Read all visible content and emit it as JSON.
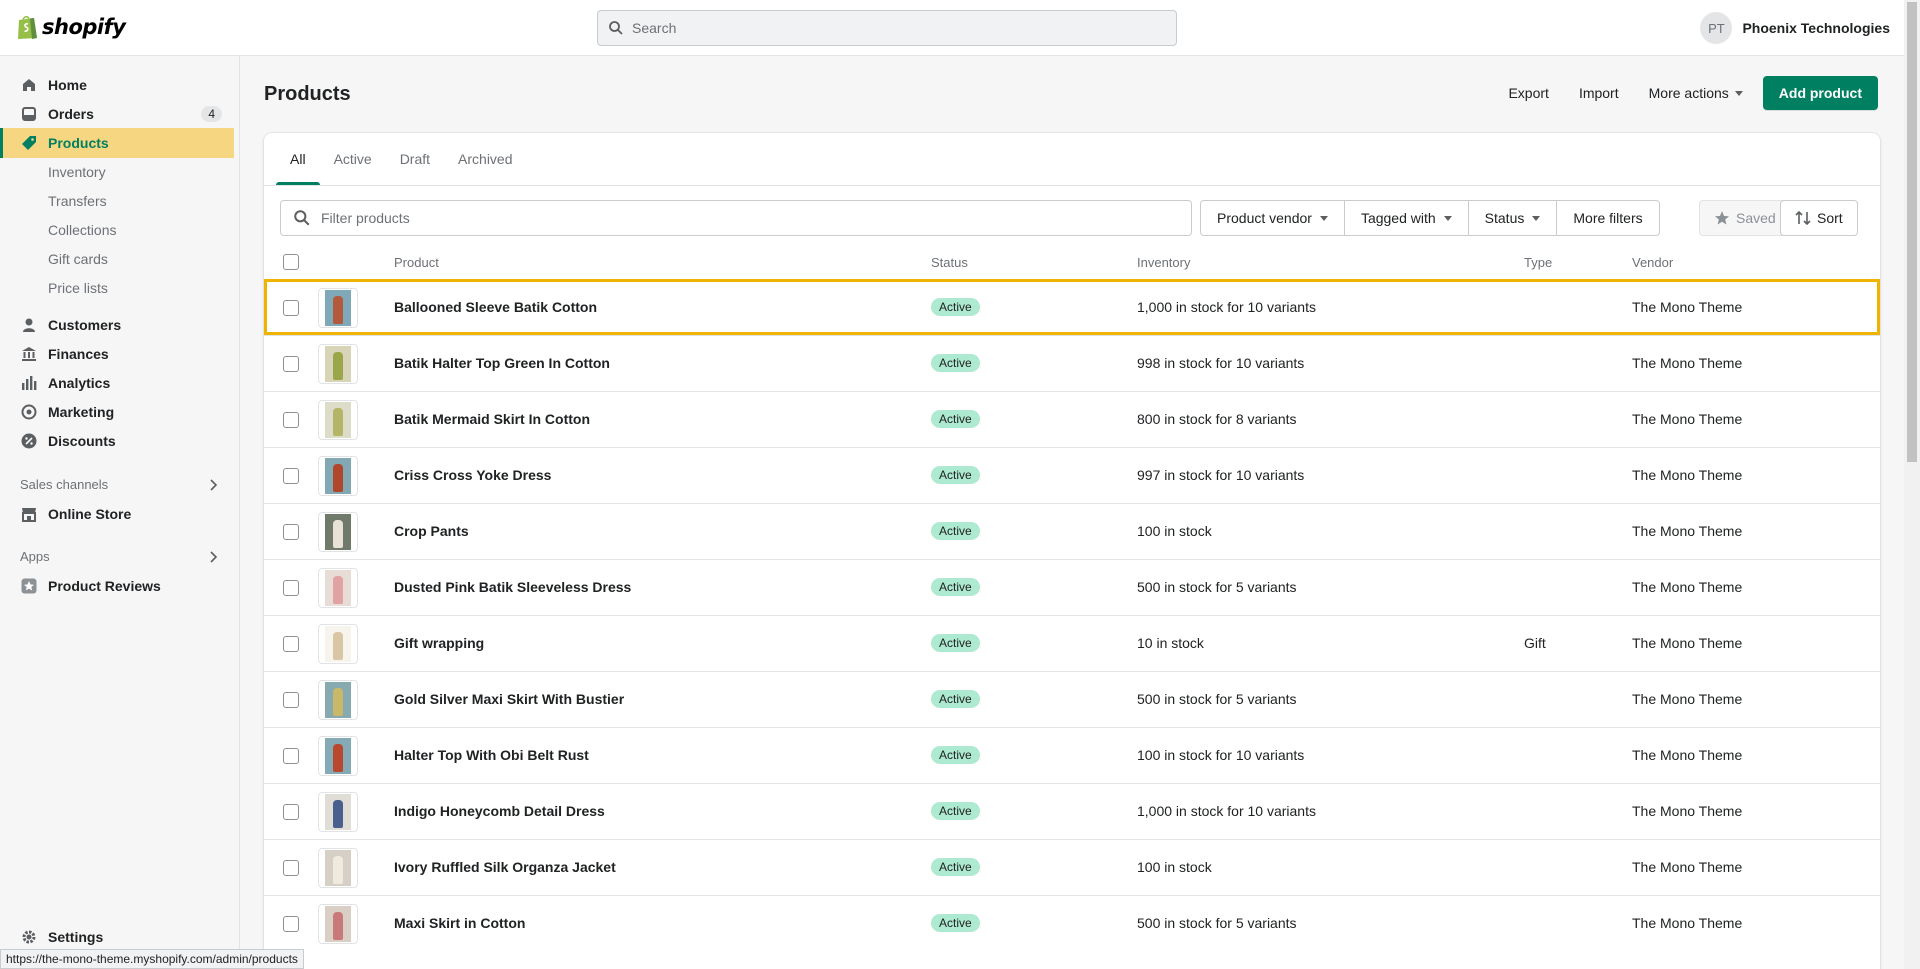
{
  "topbar": {
    "logo_text": "shopify",
    "search_placeholder": "Search",
    "user_initials": "PT",
    "store_name": "Phoenix Technologies"
  },
  "sidebar": {
    "items": [
      {
        "label": "Home",
        "icon": "home-icon"
      },
      {
        "label": "Orders",
        "icon": "orders-icon",
        "badge": "4"
      },
      {
        "label": "Products",
        "icon": "tag-icon",
        "active": true
      },
      {
        "label": "Customers",
        "icon": "person-icon"
      },
      {
        "label": "Finances",
        "icon": "bank-icon"
      },
      {
        "label": "Analytics",
        "icon": "bar-chart-icon"
      },
      {
        "label": "Marketing",
        "icon": "target-icon"
      },
      {
        "label": "Discounts",
        "icon": "discount-icon"
      }
    ],
    "sub_items": [
      "Inventory",
      "Transfers",
      "Collections",
      "Gift cards",
      "Price lists"
    ],
    "sales_channels_label": "Sales channels",
    "online_store": "Online Store",
    "apps_label": "Apps",
    "product_reviews": "Product Reviews",
    "settings": "Settings"
  },
  "status_url": "https://the-mono-theme.myshopify.com/admin/products",
  "page": {
    "title": "Products",
    "export": "Export",
    "import": "Import",
    "more_actions": "More actions",
    "add_product": "Add product"
  },
  "tabs": [
    "All",
    "Active",
    "Draft",
    "Archived"
  ],
  "filters": {
    "placeholder": "Filter products",
    "vendor": "Product vendor",
    "tagged": "Tagged with",
    "status": "Status",
    "more": "More filters",
    "saved": "Saved",
    "sort": "Sort"
  },
  "columns": {
    "product": "Product",
    "status": "Status",
    "inventory": "Inventory",
    "type": "Type",
    "vendor": "Vendor"
  },
  "products": [
    {
      "name": "Ballooned Sleeve Batik Cotton",
      "status": "Active",
      "inventory": "1,000 in stock for 10 variants",
      "type": "",
      "vendor": "The Mono Theme",
      "color": "#b45a3c",
      "bg": "#7fa8b8"
    },
    {
      "name": "Batik Halter Top Green In Cotton",
      "status": "Active",
      "inventory": "998 in stock for 10 variants",
      "type": "",
      "vendor": "The Mono Theme",
      "color": "#9aa64a",
      "bg": "#d8d4b8"
    },
    {
      "name": "Batik Mermaid Skirt In Cotton",
      "status": "Active",
      "inventory": "800 in stock for 8 variants",
      "type": "",
      "vendor": "The Mono Theme",
      "color": "#b5b56a",
      "bg": "#dcdcc8"
    },
    {
      "name": "Criss Cross Yoke Dress",
      "status": "Active",
      "inventory": "997 in stock for 10 variants",
      "type": "",
      "vendor": "The Mono Theme",
      "color": "#b0462c",
      "bg": "#82a9b3"
    },
    {
      "name": "Crop Pants",
      "status": "Active",
      "inventory": "100 in stock",
      "type": "",
      "vendor": "The Mono Theme",
      "color": "#e8e2d6",
      "bg": "#6f7a6a"
    },
    {
      "name": "Dusted Pink Batik Sleeveless Dress",
      "status": "Active",
      "inventory": "500 in stock for 5 variants",
      "type": "",
      "vendor": "The Mono Theme",
      "color": "#e0a2a2",
      "bg": "#e8dcd6"
    },
    {
      "name": "Gift wrapping",
      "status": "Active",
      "inventory": "10 in stock",
      "type": "Gift",
      "vendor": "The Mono Theme",
      "color": "#d9c6a4",
      "bg": "#f7f4ee"
    },
    {
      "name": "Gold Silver Maxi Skirt With Bustier",
      "status": "Active",
      "inventory": "500 in stock for 5 variants",
      "type": "",
      "vendor": "The Mono Theme",
      "color": "#c9b86a",
      "bg": "#86aab0"
    },
    {
      "name": "Halter Top With Obi Belt Rust",
      "status": "Active",
      "inventory": "100 in stock for 10 variants",
      "type": "",
      "vendor": "The Mono Theme",
      "color": "#b8482e",
      "bg": "#84aab6"
    },
    {
      "name": "Indigo Honeycomb Detail Dress",
      "status": "Active",
      "inventory": "1,000 in stock for 10 variants",
      "type": "",
      "vendor": "The Mono Theme",
      "color": "#4a5f8c",
      "bg": "#e0dcd6"
    },
    {
      "name": "Ivory Ruffled Silk Organza Jacket",
      "status": "Active",
      "inventory": "100 in stock",
      "type": "",
      "vendor": "The Mono Theme",
      "color": "#efe9de",
      "bg": "#d6cfc6"
    },
    {
      "name": "Maxi Skirt in Cotton",
      "status": "Active",
      "inventory": "500 in stock for 5 variants",
      "type": "",
      "vendor": "The Mono Theme",
      "color": "#c87a7a",
      "bg": "#d9cfc4"
    }
  ],
  "colors": {
    "accent": "#008060",
    "active_nav_bg": "#f7d681",
    "status_badge": "#aee9d1",
    "highlight": "#f0b400"
  }
}
